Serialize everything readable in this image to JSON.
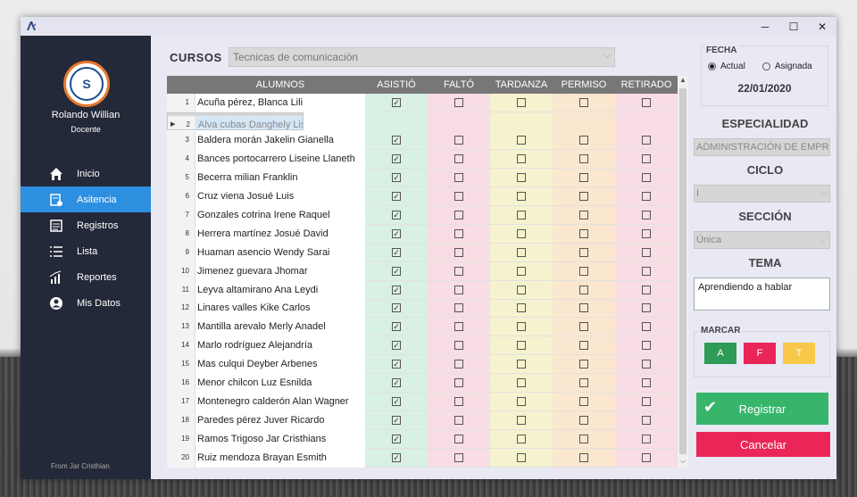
{
  "window": {
    "controls": {
      "minimize": "─",
      "maximize": "☐",
      "close": "✕"
    }
  },
  "sidebar": {
    "user_name": "Rolando Willian",
    "user_role": "Docente",
    "items": [
      {
        "label": "Inicio",
        "icon": "home-icon",
        "active": false
      },
      {
        "label": "Asitencia",
        "icon": "attendance-icon",
        "active": true
      },
      {
        "label": "Registros",
        "icon": "records-icon",
        "active": false
      },
      {
        "label": "Lista",
        "icon": "list-icon",
        "active": false
      },
      {
        "label": "Reportes",
        "icon": "chart-icon",
        "active": false
      },
      {
        "label": "Mis Datos",
        "icon": "user-icon",
        "active": false
      }
    ],
    "footer": "From Jar Cristhian"
  },
  "main": {
    "cursos_label": "CURSOS",
    "cursos_value": "Tecnicas de comunicaciòn",
    "columns": [
      "ALUMNOS",
      "ASISTIÓ",
      "FALTÓ",
      "TARDANZA",
      "PERMISO",
      "RETIRADO"
    ],
    "column_colors": {
      "asistio": "#d9f0e4",
      "falto": "#f9dde4",
      "tardanza": "#f5f3cf",
      "permiso": "#fbe7cf",
      "retirado": "#f9dde4"
    },
    "rows": [
      {
        "n": "1",
        "name": "Acuña pérez, Blanca Lili",
        "asistio": true
      },
      {
        "n": "2",
        "name": "Alva cubas Danghely Lisbeth",
        "asistio": true
      },
      {
        "n": "3",
        "name": "Baldera morán Jakelin Gianella",
        "asistio": true
      },
      {
        "n": "4",
        "name": "Bances portocarrero Liseine Llaneth",
        "asistio": true
      },
      {
        "n": "5",
        "name": "Becerra milian Franklin",
        "asistio": true
      },
      {
        "n": "6",
        "name": "Cruz viena Josué Luis",
        "asistio": true
      },
      {
        "n": "7",
        "name": "Gonzales cotrina Irene Raquel",
        "asistio": true
      },
      {
        "n": "8",
        "name": "Herrera martínez  Josué David",
        "asistio": true
      },
      {
        "n": "9",
        "name": "Huaman asencio Wendy Sarai",
        "asistio": true
      },
      {
        "n": "10",
        "name": "Jimenez guevara Jhomar",
        "asistio": true
      },
      {
        "n": "11",
        "name": "Leyva altamirano Ana Leydi",
        "asistio": true
      },
      {
        "n": "12",
        "name": "Linares valles Kike Carlos",
        "asistio": true
      },
      {
        "n": "13",
        "name": "Mantilla arevalo Merly Anadel",
        "asistio": true
      },
      {
        "n": "14",
        "name": "Marlo rodríguez Alejandría",
        "asistio": true
      },
      {
        "n": "15",
        "name": "Mas culqui Deyber Arbenes",
        "asistio": true
      },
      {
        "n": "16",
        "name": "Menor chilcon Luz Esnilda",
        "asistio": true
      },
      {
        "n": "17",
        "name": "Montenegro calderón Alan Wagner",
        "asistio": true
      },
      {
        "n": "18",
        "name": "Paredes pérez Juver Ricardo",
        "asistio": true
      },
      {
        "n": "19",
        "name": "Ramos Trigoso Jar Cristhians",
        "asistio": true
      },
      {
        "n": "20",
        "name": "Ruiz mendoza Brayan Esmith",
        "asistio": true
      }
    ],
    "selected_row": 2
  },
  "right": {
    "fecha_label": "FECHA",
    "radio_actual": "Actual",
    "radio_asignada": "Asignada",
    "radio_selected": "actual",
    "date": "22/01/2020",
    "especialidad_label": "ESPECIALIDAD",
    "especialidad_value": "ADMINISTRACIÓN DE EMPRE",
    "ciclo_label": "CICLO",
    "ciclo_value": "I",
    "seccion_label": "SECCIÓN",
    "seccion_value": "Única",
    "tema_label": "TEMA",
    "tema_value": "Aprendiendo a hablar",
    "marcar_label": "MARCAR",
    "marcar_buttons": [
      {
        "label": "A",
        "color": "#2e9b57"
      },
      {
        "label": "F",
        "color": "#ea2557"
      },
      {
        "label": "T",
        "color": "#f7c84a"
      }
    ],
    "registrar_label": "Registrar",
    "cancelar_label": "Cancelar"
  }
}
